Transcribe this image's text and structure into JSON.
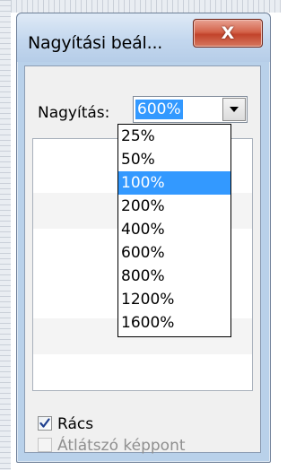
{
  "window": {
    "title": "Nagyítási beál...",
    "close_label": "X"
  },
  "zoom": {
    "label": "Nagyítás:",
    "current_value": "600%",
    "options": [
      "25%",
      "50%",
      "100%",
      "200%",
      "400%",
      "600%",
      "800%",
      "1200%",
      "1600%"
    ],
    "highlighted": "100%"
  },
  "options": {
    "grid_label": "Rács",
    "grid_checked": true,
    "transparent_label": "Átlátszó képpont",
    "transparent_checked": false,
    "transparent_enabled": false
  },
  "colors": {
    "selection": "#3399ff",
    "close_button": "#c2432b",
    "frame": "#b9d1ea"
  }
}
